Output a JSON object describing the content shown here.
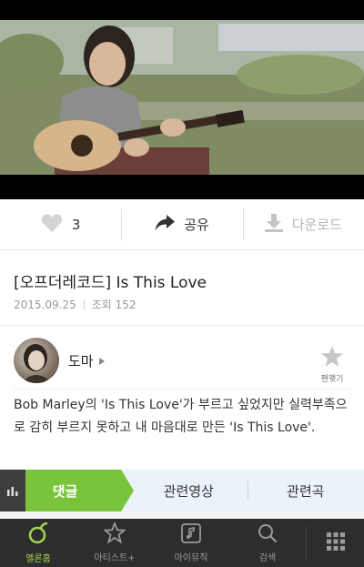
{
  "actions": {
    "like_count": "3",
    "share_label": "공유",
    "download_label": "다운로드"
  },
  "video": {
    "title": "[오프더레코드] Is This Love",
    "date": "2015.09.25",
    "views": "조회 152"
  },
  "artist": {
    "name": "도마",
    "fan_label": "팬맺기"
  },
  "description": "Bob Marley의 'Is This Love'가 부르고 싶었지만 실력부족으로 감히 부르지 못하고 내 마음대로 만든 'Is This Love'.",
  "tabs": [
    {
      "label": "댓글"
    },
    {
      "label": "관련영상"
    },
    {
      "label": "관련곡"
    }
  ],
  "bottom_nav": [
    {
      "label": "멜론홈",
      "icon": "melon-icon"
    },
    {
      "label": "아티스트+",
      "icon": "star-icon"
    },
    {
      "label": "마이뮤직",
      "icon": "music-note-icon"
    },
    {
      "label": "검색",
      "icon": "search-icon"
    },
    {
      "label": "",
      "icon": "grid-menu-icon"
    }
  ],
  "colors": {
    "accent_green": "#79c43a",
    "nav_active": "#a6d54f",
    "nav_bg": "#2d2d2d",
    "tabs_bg": "#ebf2fa"
  }
}
